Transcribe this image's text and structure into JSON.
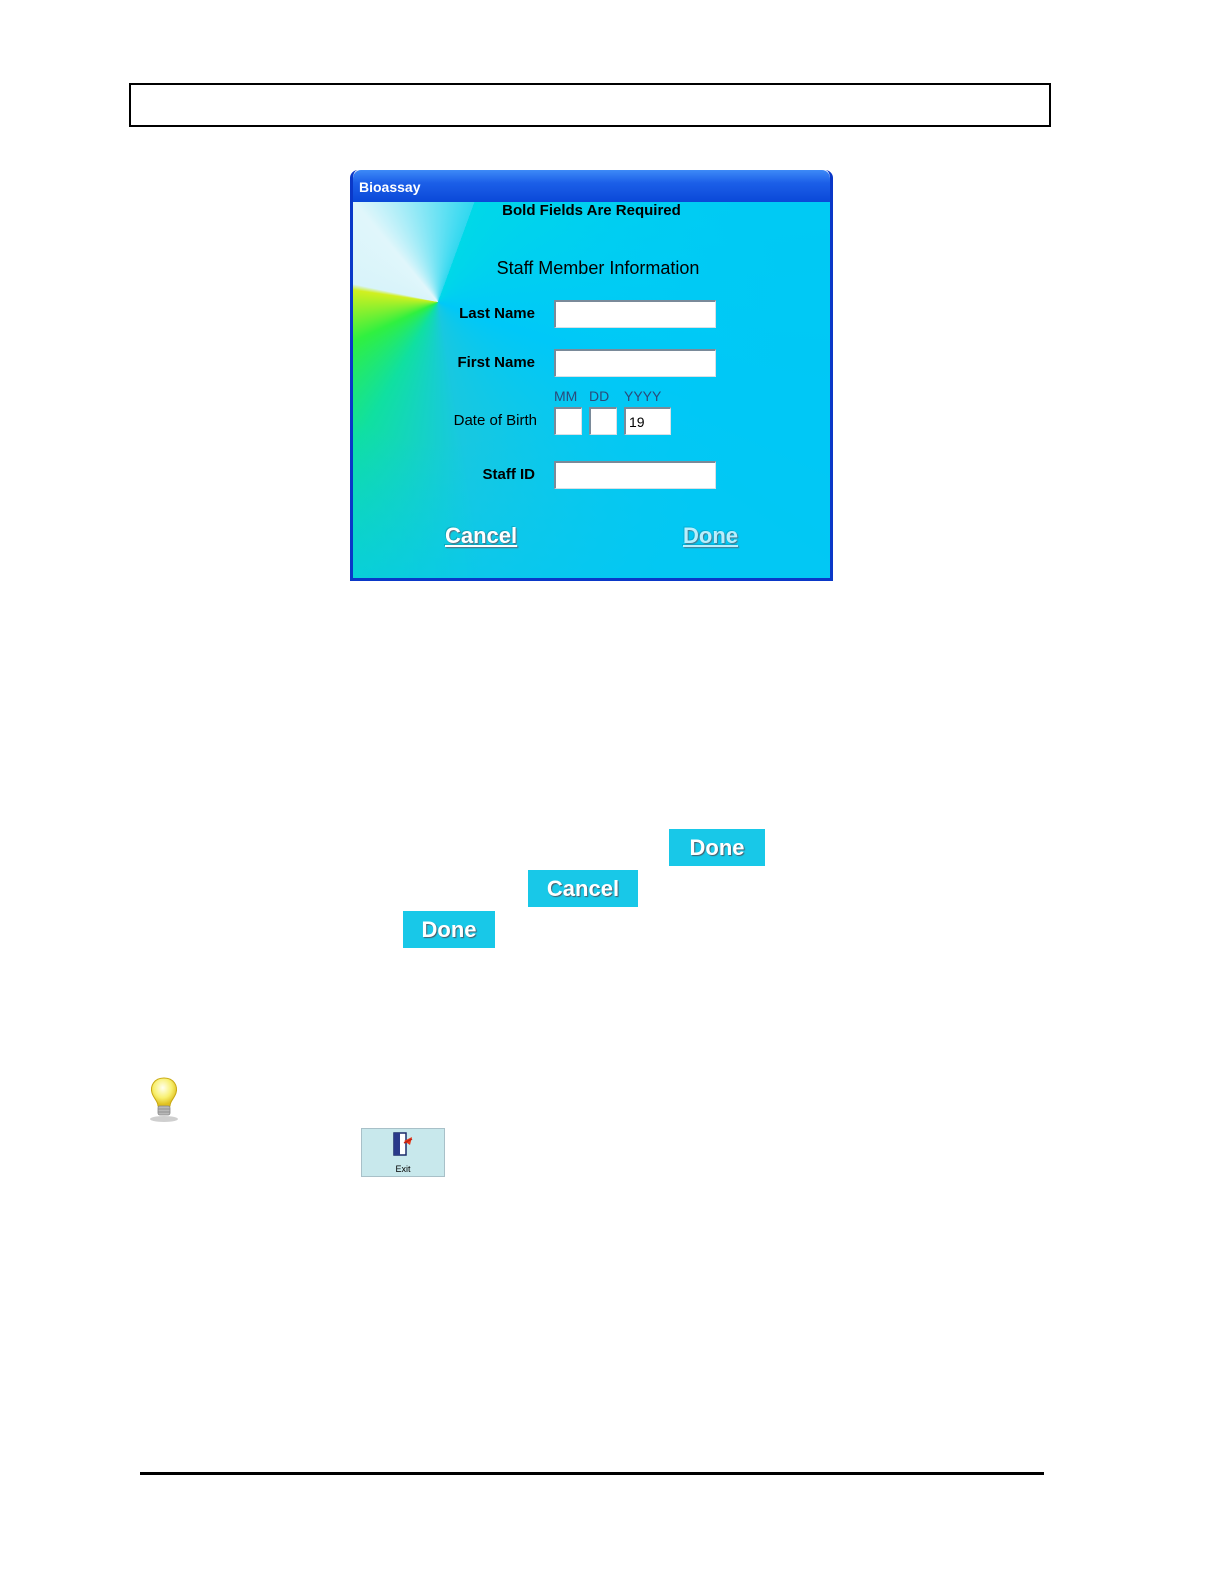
{
  "window": {
    "title": "Bioassay"
  },
  "form": {
    "required_note": "Bold Fields Are Required",
    "section_title": "Staff Member Information",
    "last_name": {
      "label": "Last Name",
      "value": ""
    },
    "first_name": {
      "label": "First Name",
      "value": ""
    },
    "dob": {
      "label": "Date of Birth",
      "mm_label": "MM",
      "dd_label": "DD",
      "yyyy_label": "YYYY",
      "mm_value": "",
      "dd_value": "",
      "yyyy_value": "19"
    },
    "staff_id": {
      "label": "Staff ID",
      "value": ""
    },
    "cancel_label": "Cancel",
    "done_label": "Done"
  },
  "inline_buttons": {
    "done_1": "Done",
    "cancel": "Cancel",
    "done_2": "Done"
  },
  "toolbar": {
    "exit_label": "Exit"
  },
  "icons": [
    "lightbulb-icon",
    "exit-door-icon"
  ]
}
